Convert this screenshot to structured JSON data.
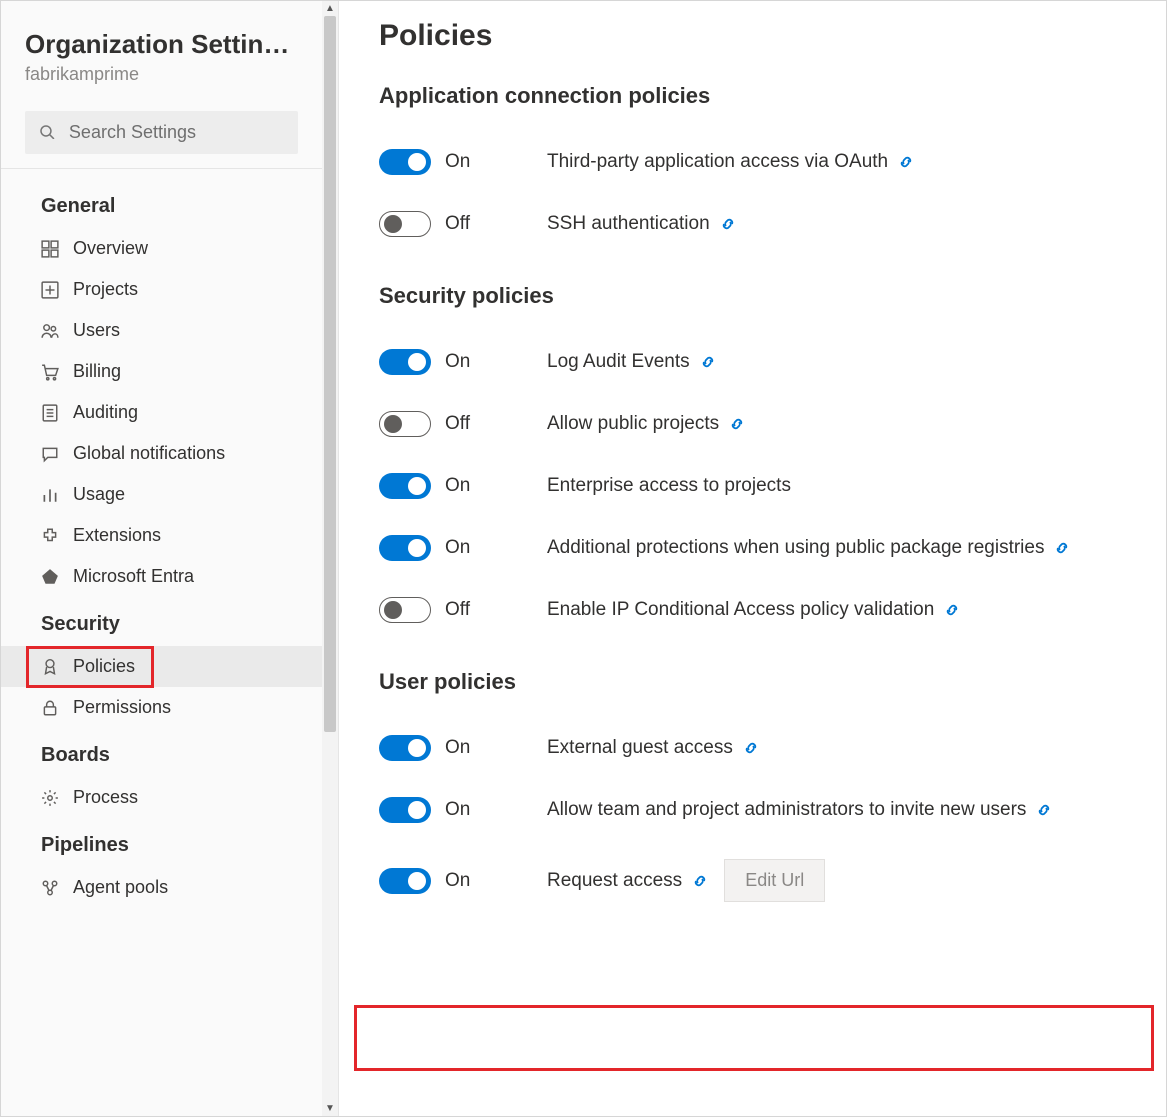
{
  "sidebar": {
    "title": "Organization Settin…",
    "subtitle": "fabrikamprime",
    "searchPlaceholder": "Search Settings",
    "groups": [
      {
        "title": "General",
        "items": [
          {
            "id": "overview",
            "label": "Overview"
          },
          {
            "id": "projects",
            "label": "Projects"
          },
          {
            "id": "users",
            "label": "Users"
          },
          {
            "id": "billing",
            "label": "Billing"
          },
          {
            "id": "auditing",
            "label": "Auditing"
          },
          {
            "id": "global-notifications",
            "label": "Global notifications"
          },
          {
            "id": "usage",
            "label": "Usage"
          },
          {
            "id": "extensions",
            "label": "Extensions"
          },
          {
            "id": "microsoft-entra",
            "label": "Microsoft Entra"
          }
        ]
      },
      {
        "title": "Security",
        "items": [
          {
            "id": "policies",
            "label": "Policies",
            "selected": true
          },
          {
            "id": "permissions",
            "label": "Permissions"
          }
        ]
      },
      {
        "title": "Boards",
        "items": [
          {
            "id": "process",
            "label": "Process"
          }
        ]
      },
      {
        "title": "Pipelines",
        "items": [
          {
            "id": "agent-pools",
            "label": "Agent pools"
          }
        ]
      }
    ]
  },
  "main": {
    "title": "Policies",
    "labels": {
      "on": "On",
      "off": "Off",
      "editUrl": "Edit Url"
    },
    "sections": [
      {
        "title": "Application connection policies",
        "policies": [
          {
            "id": "oauth",
            "state": "on",
            "desc": "Third-party application access via OAuth",
            "link": true
          },
          {
            "id": "ssh",
            "state": "off",
            "desc": "SSH authentication",
            "link": true
          }
        ]
      },
      {
        "title": "Security policies",
        "policies": [
          {
            "id": "audit",
            "state": "on",
            "desc": "Log Audit Events",
            "link": true
          },
          {
            "id": "public-projects",
            "state": "off",
            "desc": "Allow public projects",
            "link": true
          },
          {
            "id": "enterprise-access",
            "state": "on",
            "desc": "Enterprise access to projects",
            "link": false
          },
          {
            "id": "package-protections",
            "state": "on",
            "desc": "Additional protections when using public package registries",
            "link": true
          },
          {
            "id": "ip-conditional",
            "state": "off",
            "desc": "Enable IP Conditional Access policy validation",
            "link": true
          }
        ]
      },
      {
        "title": "User policies",
        "policies": [
          {
            "id": "guest-access",
            "state": "on",
            "desc": "External guest access",
            "link": true
          },
          {
            "id": "invite-users",
            "state": "on",
            "desc": "Allow team and project administrators to invite new users",
            "link": true
          },
          {
            "id": "request-access",
            "state": "on",
            "desc": "Request access",
            "link": true,
            "editUrl": true
          }
        ]
      }
    ]
  }
}
